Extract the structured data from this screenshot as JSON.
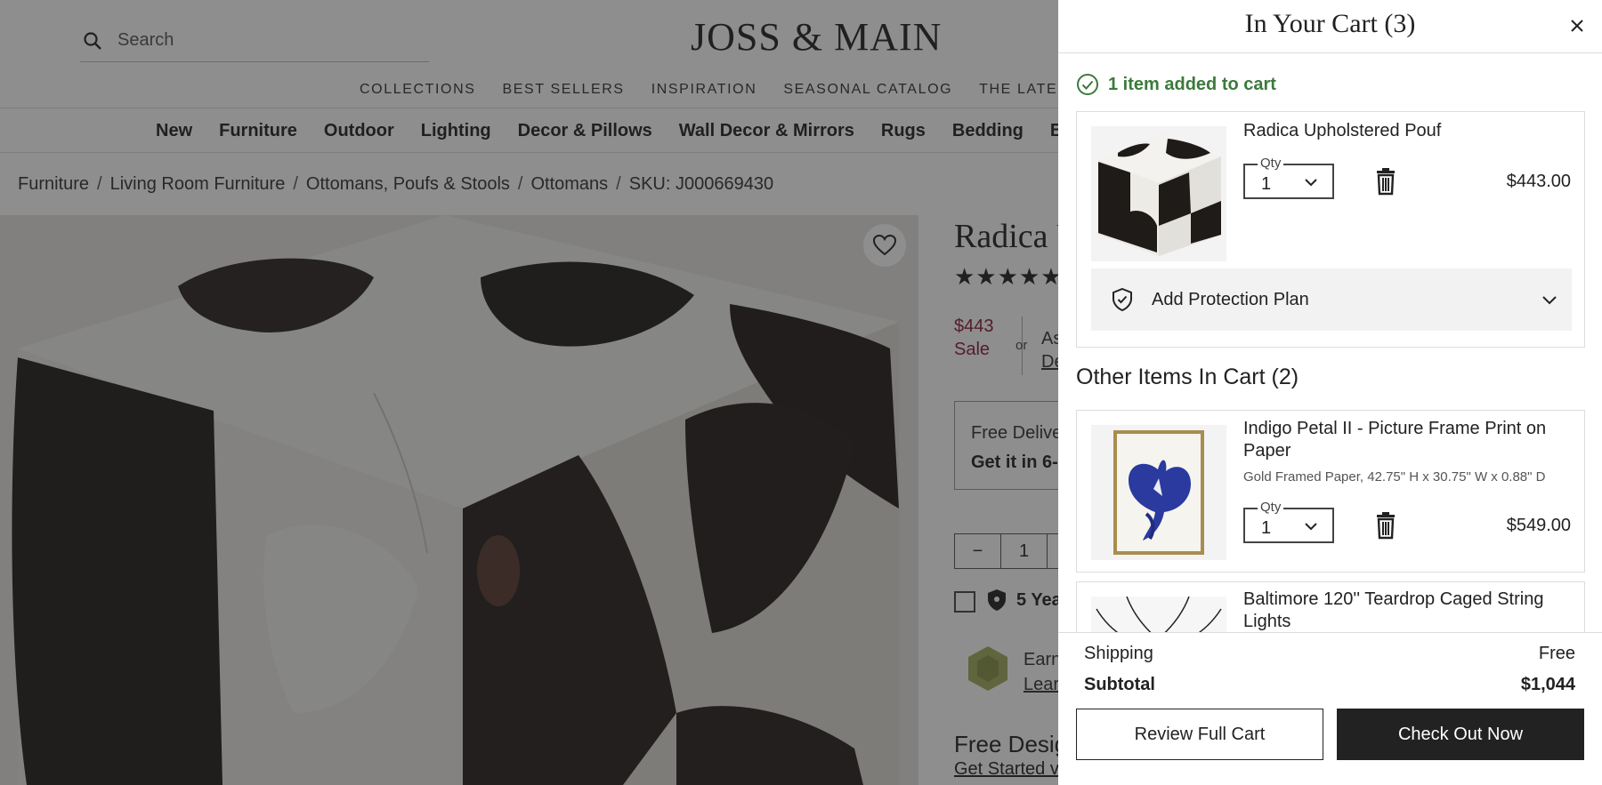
{
  "site": {
    "logo": "JOSS & MAIN",
    "search_placeholder": "Search",
    "top_nav": [
      "COLLECTIONS",
      "BEST SELLERS",
      "INSPIRATION",
      "SEASONAL CATALOG",
      "THE LATEST"
    ],
    "categories": [
      "New",
      "Furniture",
      "Outdoor",
      "Lighting",
      "Decor & Pillows",
      "Wall Decor & Mirrors",
      "Rugs",
      "Bedding",
      "Bath"
    ],
    "breadcrumb": [
      "Furniture",
      "Living Room Furniture",
      "Ottomans, Poufs & Stools",
      "Ottomans",
      "SKU: J000669430"
    ],
    "breadcrumb_sep": "/"
  },
  "product": {
    "title_partial": "Radica U",
    "stars": "★★★★★",
    "price": "$443",
    "price_note": "Sale",
    "or": "or",
    "as_partial": "As",
    "de_partial": "De",
    "delivery_line1": "Free Delive",
    "delivery_line2": "Get it in 6-",
    "qty": "1",
    "qty_minus": "−",
    "protection_partial": "5 Yea",
    "earn_partial": "Earn",
    "learn_partial": "Lear",
    "design_partial": "Free Desig",
    "get_started_partial": "Get Started v"
  },
  "cart": {
    "title": "In Your Cart (3)",
    "added_message": "1 item added to cart",
    "added_item": {
      "name": "Radica Upholstered Pouf",
      "qty_label": "Qty",
      "qty": "1",
      "price": "$443.00",
      "protection_label": "Add Protection Plan"
    },
    "other_heading": "Other Items In Cart (2)",
    "other_items": [
      {
        "name": "Indigo Petal II - Picture Frame Print on Paper",
        "variant": "Gold Framed Paper, 42.75\" H x 30.75\" W x 0.88\" D",
        "qty_label": "Qty",
        "qty": "1",
        "price": "$549.00"
      },
      {
        "name": "Baltimore 120'' Teardrop Caged String Lights"
      }
    ],
    "shipping_label": "Shipping",
    "shipping_value": "Free",
    "subtotal_label": "Subtotal",
    "subtotal_value": "$1,044",
    "review_button": "Review Full Cart",
    "checkout_button": "Check Out Now"
  },
  "colors": {
    "success_green": "#3b7a3b",
    "sale_red": "#8a1c3a",
    "dark": "#222222"
  }
}
